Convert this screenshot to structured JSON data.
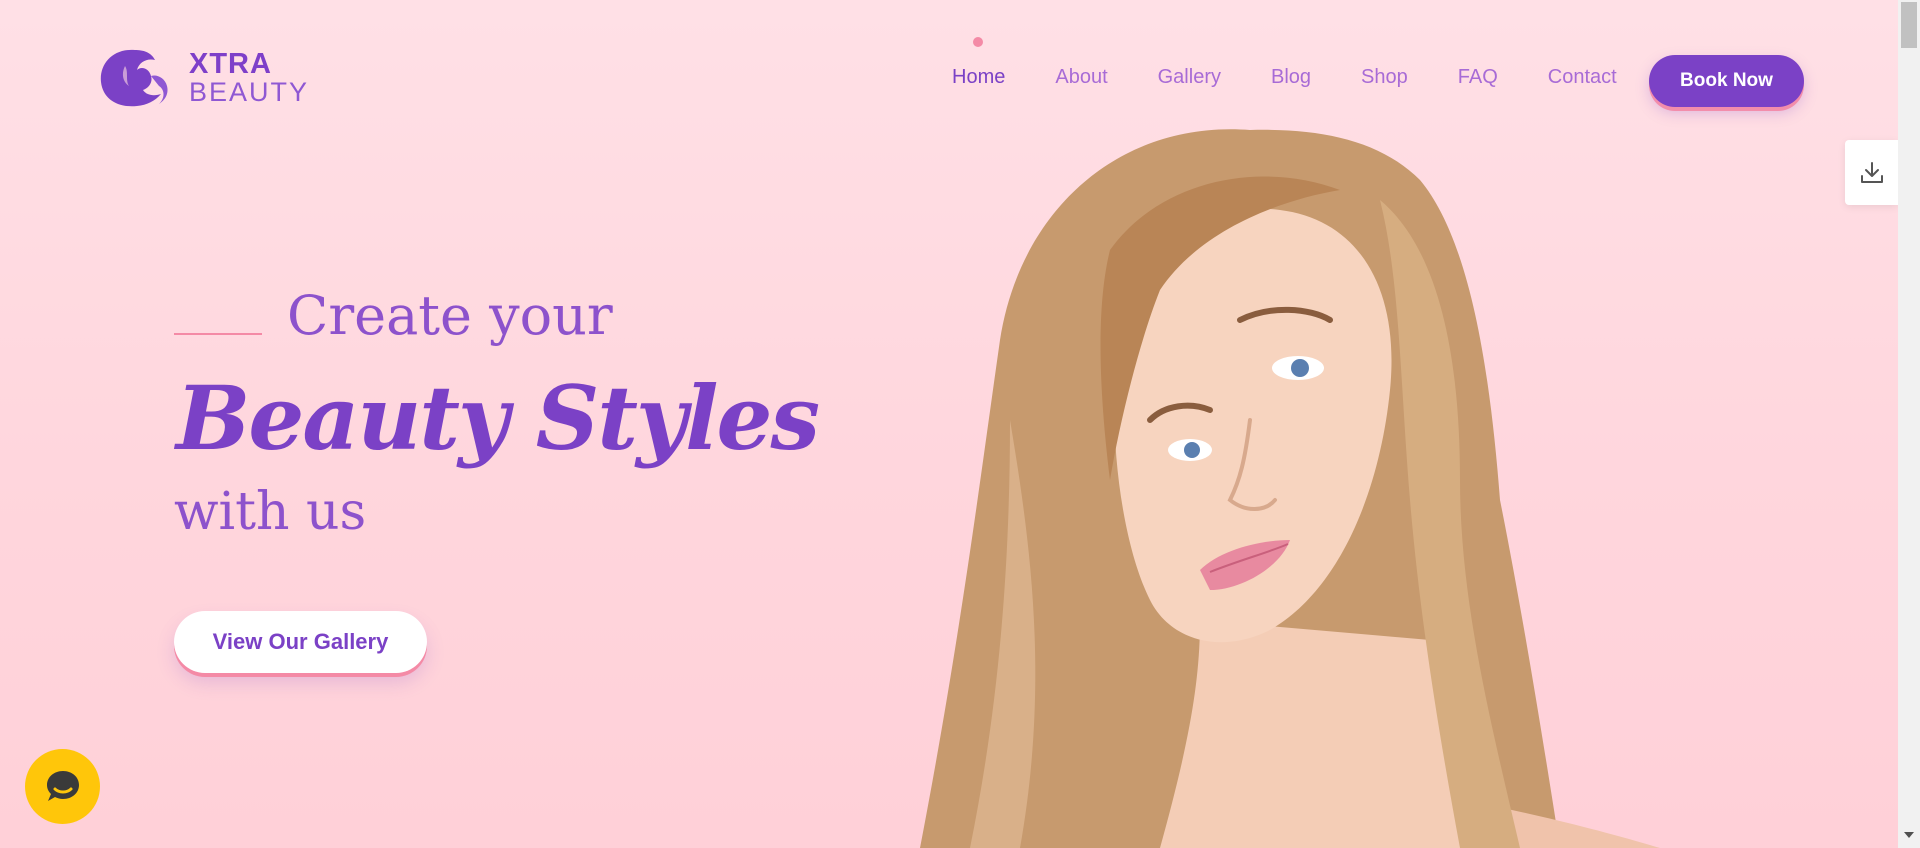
{
  "logo": {
    "line1": "XTRA",
    "line2": "BEAUTY"
  },
  "nav": {
    "items": [
      {
        "label": "Home",
        "active": true
      },
      {
        "label": "About"
      },
      {
        "label": "Gallery"
      },
      {
        "label": "Blog"
      },
      {
        "label": "Shop"
      },
      {
        "label": "FAQ"
      },
      {
        "label": "Contact"
      }
    ],
    "cta": "Book Now"
  },
  "hero": {
    "line1": "Create your",
    "line2": "Beauty Styles",
    "line3": "with us",
    "button": "View Our Gallery"
  },
  "icons": {
    "side_tab": "download-icon",
    "chat": "chat-bubble-icon",
    "logo": "woman-silhouette-icon"
  },
  "colors": {
    "primary": "#7b41c6",
    "accent": "#f48aa6",
    "background": "#ffdbe2",
    "chat": "#ffc60a"
  }
}
